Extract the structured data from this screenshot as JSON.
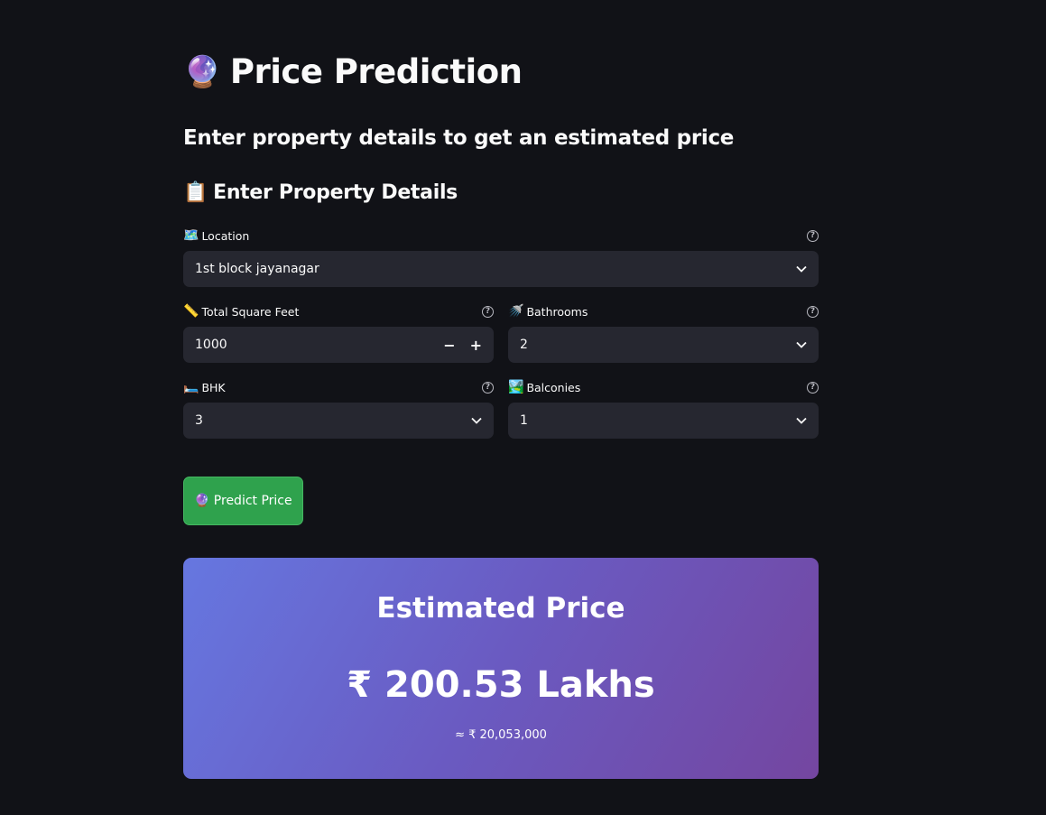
{
  "header": {
    "title_icon": "🔮",
    "title": "Price Prediction",
    "subtitle": "Enter property details to get an estimated price"
  },
  "section": {
    "icon": "📋",
    "heading": "Enter Property Details"
  },
  "fields": {
    "location": {
      "icon": "🗺️",
      "label": "Location",
      "value": "1st block jayanagar"
    },
    "total_sqft": {
      "icon": "📏",
      "label": "Total Square Feet",
      "value": "1000",
      "minus": "−",
      "plus": "+"
    },
    "bathrooms": {
      "icon": "🚿",
      "label": "Bathrooms",
      "value": "2"
    },
    "bhk": {
      "icon": "🛏️",
      "label": "BHK",
      "value": "3"
    },
    "balconies": {
      "icon": "🏞️",
      "label": "Balconies",
      "value": "1"
    }
  },
  "icons": {
    "help": "?",
    "chevron": "⌄"
  },
  "predict_button": {
    "icon": "🔮",
    "label": "Predict Price"
  },
  "result": {
    "title": "Estimated Price",
    "price": "₹ 200.53 Lakhs",
    "approx": "≈ ₹ 20,053,000"
  },
  "colors": {
    "background": "#111217",
    "input_bg": "#262730",
    "button_green": "#2fa24d",
    "card_gradient_start": "#6677e0",
    "card_gradient_end": "#7446a0"
  }
}
